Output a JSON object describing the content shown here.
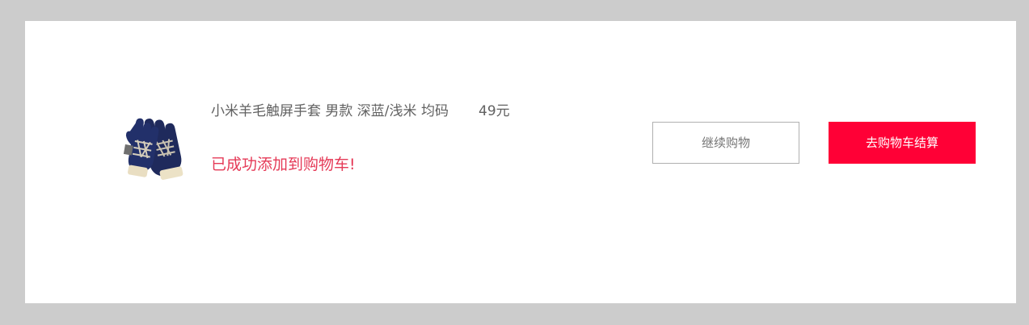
{
  "product": {
    "name": "小米羊毛触屏手套 男款 深蓝/浅米 均码",
    "price": "49元",
    "image_icon": "glove-image"
  },
  "message": {
    "success": "已成功添加到购物车!"
  },
  "actions": {
    "continue_label": "继续购物",
    "checkout_label": "去购物车结算"
  },
  "colors": {
    "accent": "#ff0036",
    "success_text": "#e53a57",
    "backdrop": "#cccccc"
  }
}
